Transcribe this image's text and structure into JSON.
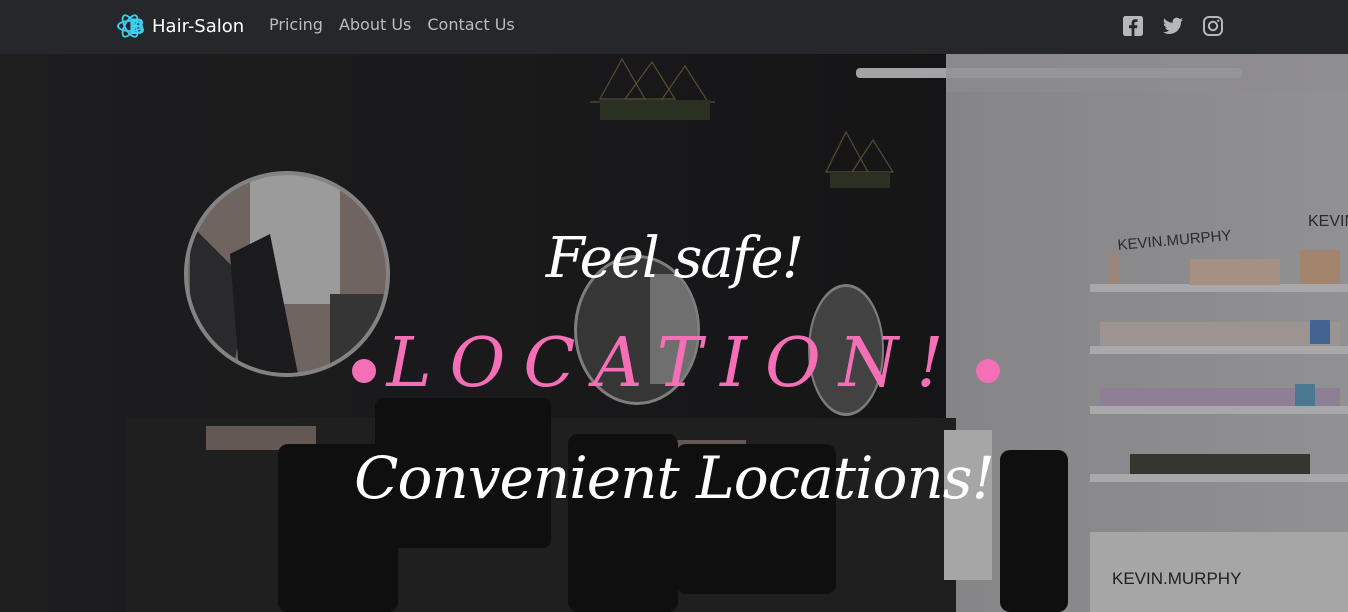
{
  "navbar": {
    "brand": {
      "text": "Hair-Salon",
      "icon": "react-atom-b-icon",
      "color": "#3fd0f0"
    },
    "links": [
      {
        "label": "Pricing"
      },
      {
        "label": "About Us"
      },
      {
        "label": "Contact Us"
      }
    ],
    "socials": [
      {
        "icon": "facebook-icon"
      },
      {
        "icon": "twitter-icon"
      },
      {
        "icon": "instagram-icon"
      }
    ]
  },
  "hero": {
    "background_image": "hair-salon-interior-photo",
    "line1": "Feel safe!",
    "line2": "LOCATION!",
    "line3": "Convenient Locations!",
    "accent_color": "#f46fb6",
    "sign_left": "KEVIN.MURPHY",
    "sign_shelf": "KEVIN.MURPHY",
    "sign_counter": "KEVIN.MURPHY"
  }
}
